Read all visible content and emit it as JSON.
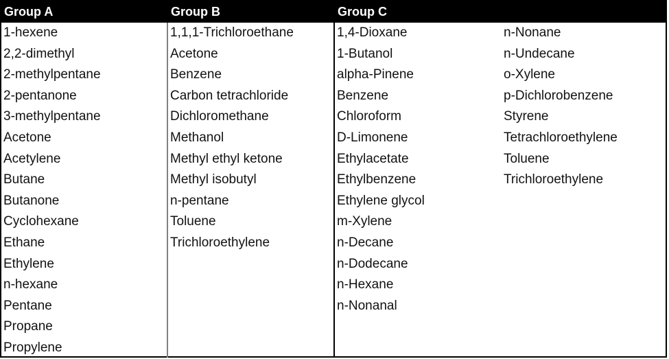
{
  "headers": {
    "group_a": "Group A",
    "group_b": "Group B",
    "group_c": "Group C"
  },
  "group_a": [
    "1-hexene",
    "2,2-dimethyl",
    "2-methylpentane",
    "2-pentanone",
    "3-methylpentane",
    "Acetone",
    "Acetylene",
    "Butane",
    "Butanone",
    "Cyclohexane",
    "Ethane",
    "Ethylene",
    "n-hexane",
    "Pentane",
    "Propane",
    "Propylene"
  ],
  "group_b": [
    "1,1,1-Trichloroethane",
    "Acetone",
    "Benzene",
    "Carbon tetrachloride",
    "Dichloromethane",
    "Methanol",
    "Methyl ethyl ketone",
    "Methyl isobutyl",
    "n-pentane",
    "Toluene",
    "Trichloroethylene"
  ],
  "group_c_col1": [
    "1,4-Dioxane",
    "1-Butanol",
    "alpha-Pinene",
    "Benzene",
    "Chloroform",
    "D-Limonene",
    "Ethylacetate",
    "Ethylbenzene",
    "Ethylene glycol",
    "m-Xylene",
    "n-Decane",
    "n-Dodecane",
    "n-Hexane",
    "n-Nonanal"
  ],
  "group_c_col2": [
    "n-Nonane",
    "n-Undecane",
    "o-Xylene",
    "p-Dichlorobenzene",
    "Styrene",
    "Tetrachloroethylene",
    "Toluene",
    "Trichloroethylene"
  ]
}
